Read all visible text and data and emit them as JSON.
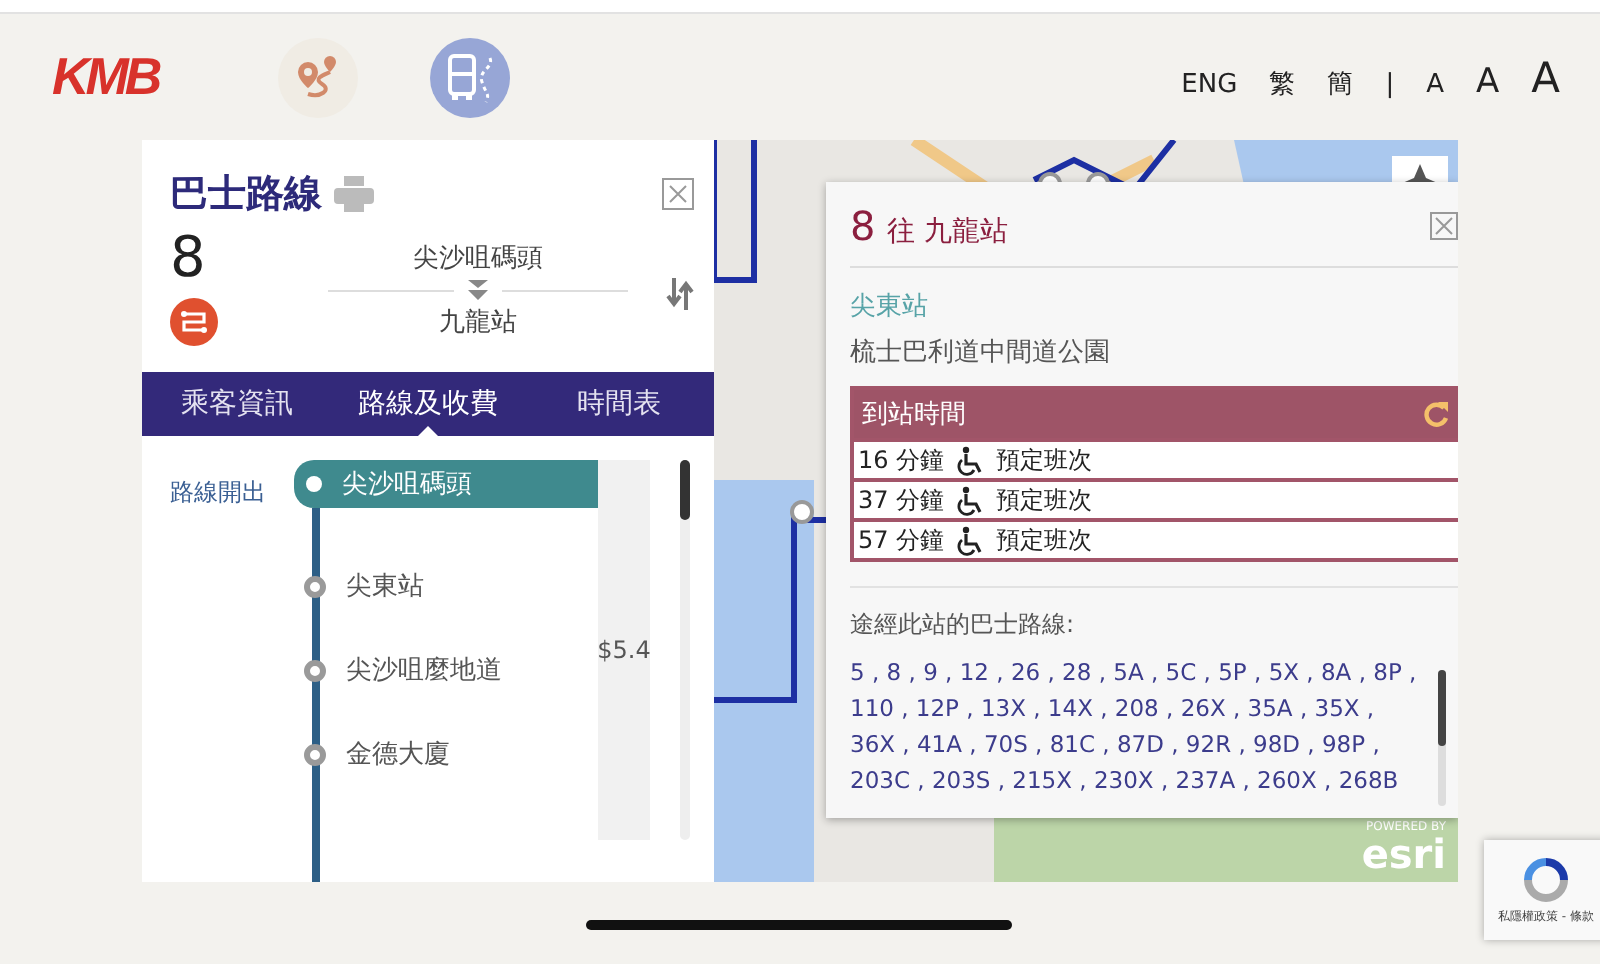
{
  "header": {
    "logo": "KMB",
    "languages": [
      {
        "label": "ENG"
      },
      {
        "label": "繁"
      },
      {
        "label": "簡"
      }
    ],
    "separator": "|",
    "font_sizes": [
      {
        "label": "A",
        "kind": "small"
      },
      {
        "label": "A",
        "kind": "medium"
      },
      {
        "label": "A",
        "kind": "large"
      }
    ]
  },
  "route_panel": {
    "title": "巴士路線",
    "route_number": "8",
    "origin": "尖沙咀碼頭",
    "destination": "九龍站",
    "tabs": [
      {
        "label": "乘客資訊",
        "selected": false
      },
      {
        "label": "路線及收費",
        "selected": true
      },
      {
        "label": "時間表",
        "selected": false
      }
    ],
    "direction_label": "路線開出",
    "fare": "$5.4",
    "stops": [
      {
        "name": "尖沙咀碼頭",
        "selected": true
      },
      {
        "name": "尖東站",
        "selected": false
      },
      {
        "name": "尖沙咀麼地道",
        "selected": false
      },
      {
        "name": "金德大廈",
        "selected": false
      }
    ]
  },
  "stop_popup": {
    "route_number": "8",
    "heading": "往 九龍站",
    "stop_name": "尖東站",
    "address": "梳士巴利道中間道公園",
    "eta_title": "到站時間",
    "etas": [
      {
        "time": "16 分鐘",
        "note": "預定班次"
      },
      {
        "time": "37 分鐘",
        "note": "預定班次"
      },
      {
        "time": "57 分鐘",
        "note": "預定班次"
      }
    ],
    "routes_label": "途經此站的巴士路線:",
    "routes": "5 , 8 , 9 , 12 , 26 , 28 , 5A , 5C , 5P , 5X , 8A , 8P , 110 , 12P , 13X , 14X , 208 , 26X , 35A , 35X , 36X , 41A , 70S , 81C , 87D , 92R , 98D , 98P , 203C , 203S , 215X , 230X , 237A , 260X , 268B"
  },
  "map": {
    "attribution_small": "POWERED BY",
    "attribution": "esri"
  },
  "recaptcha": {
    "label": "私隱權政策 - 條款"
  }
}
